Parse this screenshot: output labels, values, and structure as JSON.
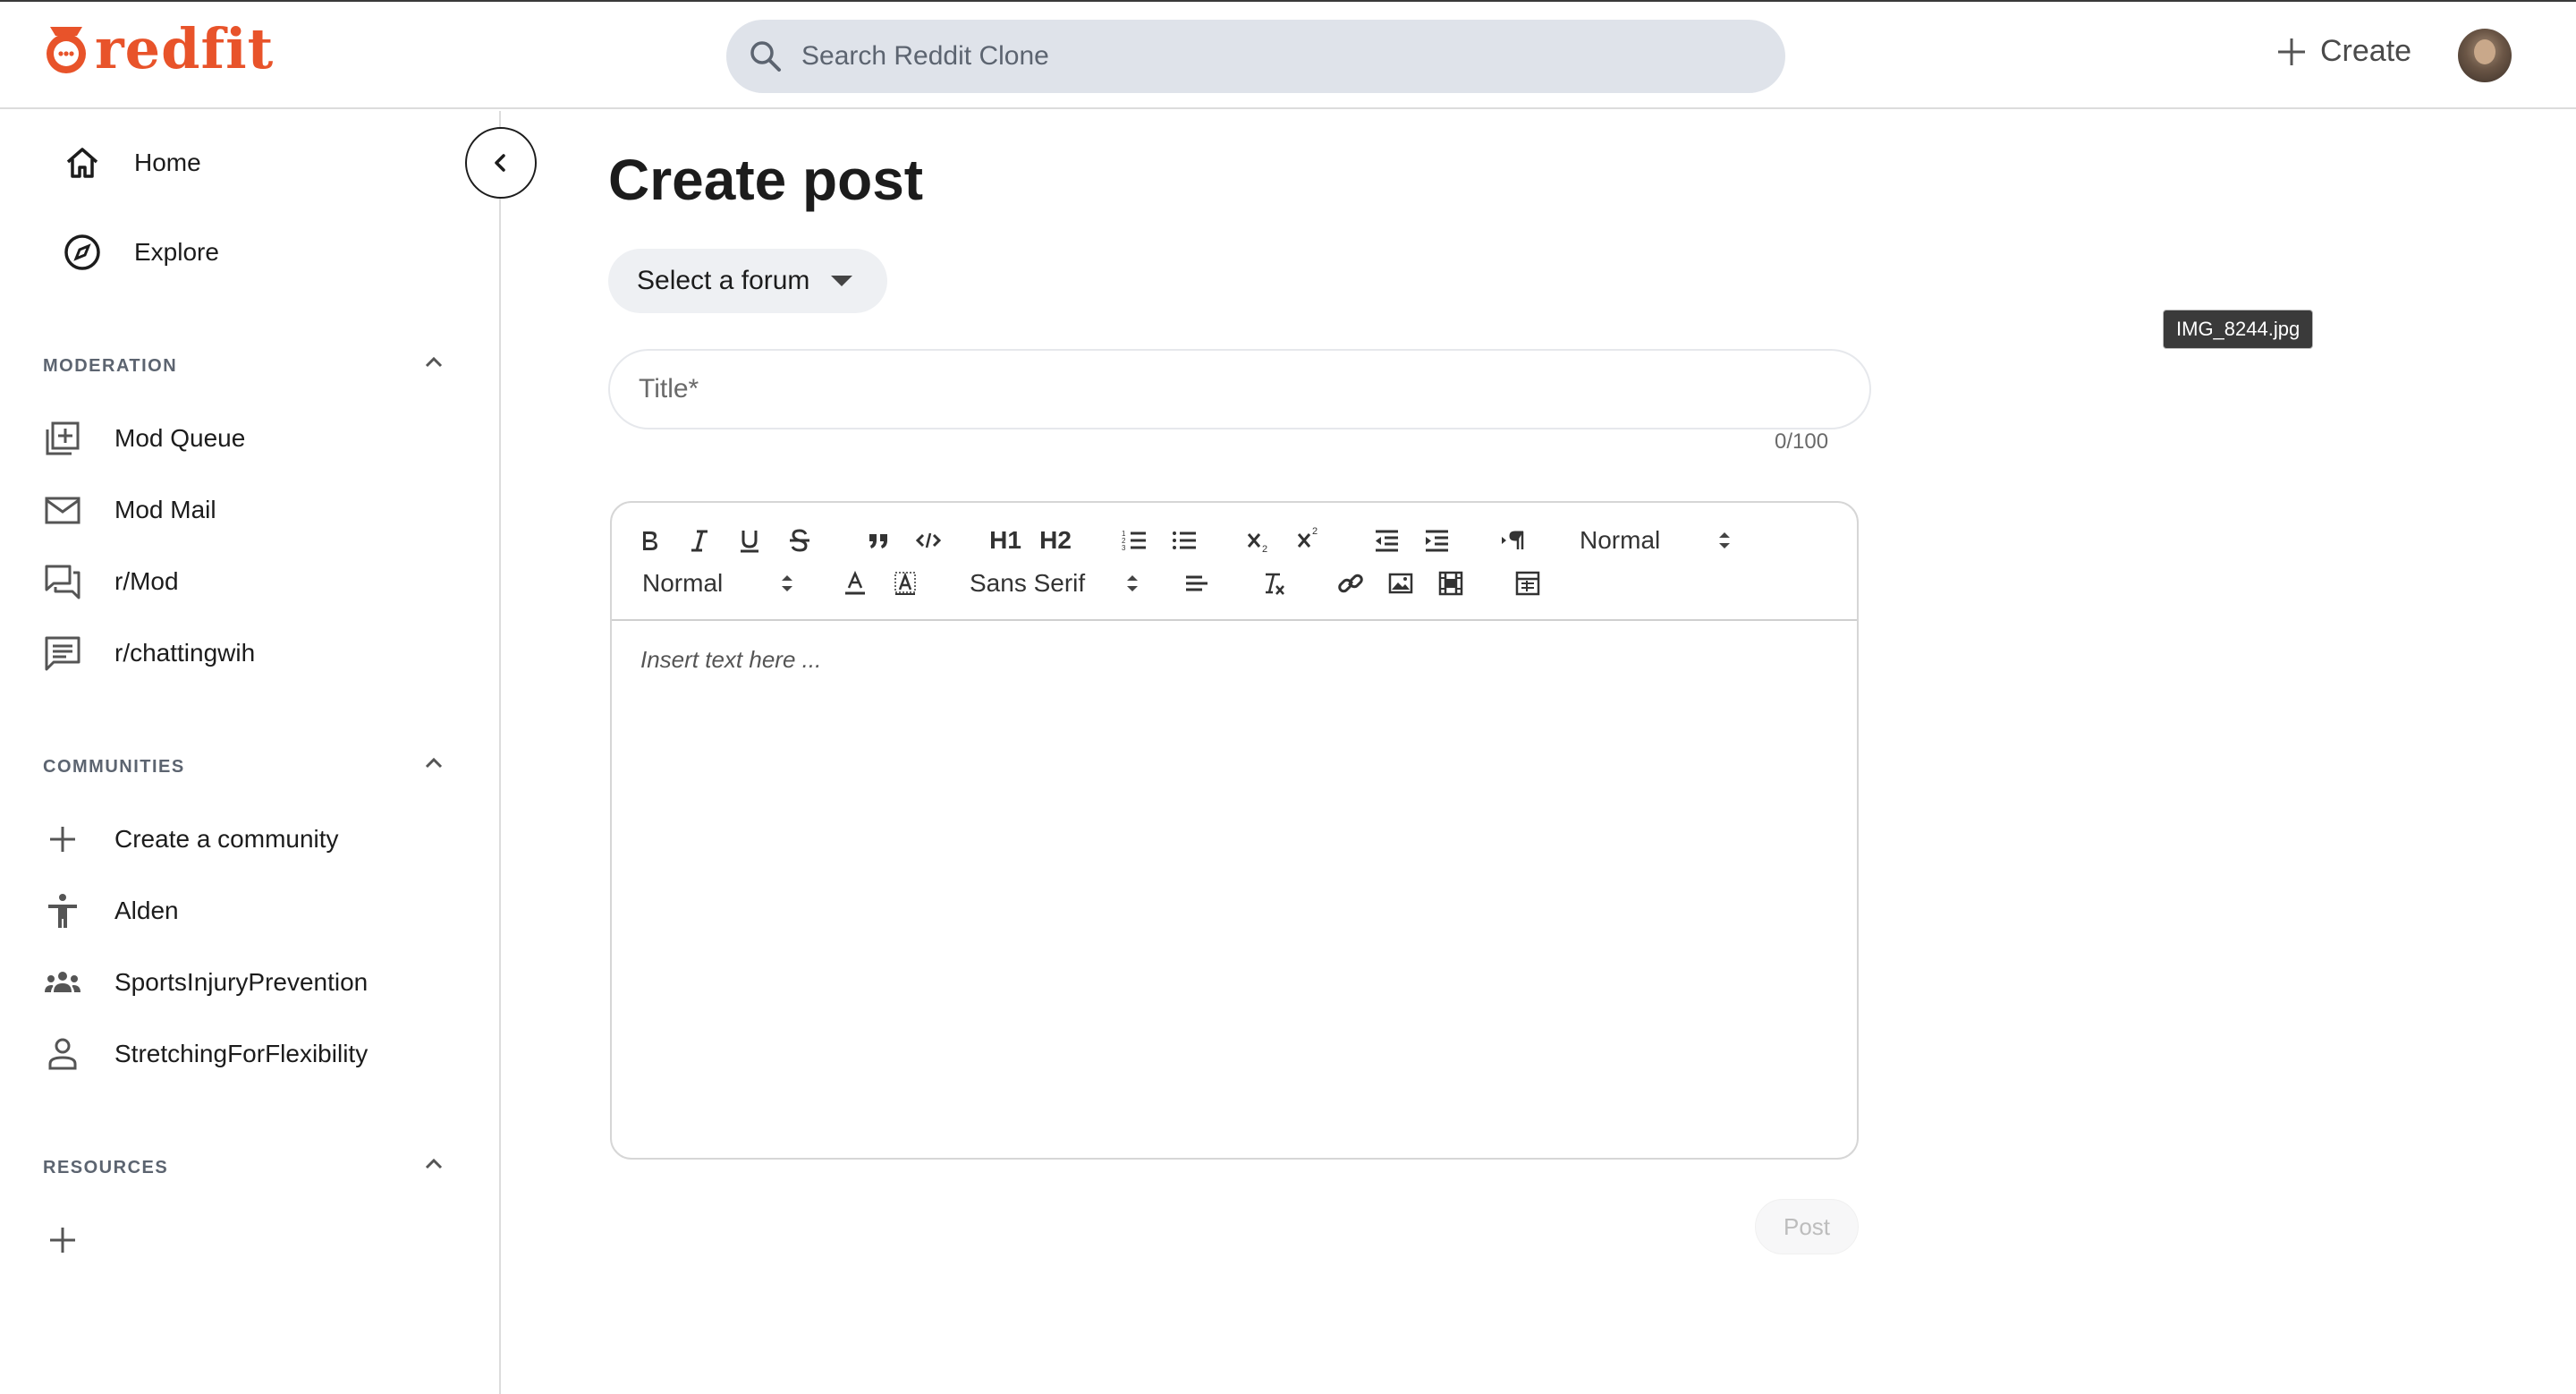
{
  "app": {
    "name": "redfit"
  },
  "colors": {
    "brand": "#e8532a",
    "search_bg": "#dfe3ea",
    "text": "#1c1c1c"
  },
  "header": {
    "search_placeholder": "Search Reddit Clone",
    "create_label": "Create"
  },
  "sidebar": {
    "nav": [
      {
        "label": "Home",
        "icon": "home-icon"
      },
      {
        "label": "Explore",
        "icon": "compass-icon"
      }
    ],
    "moderation": {
      "title": "MODERATION",
      "items": [
        {
          "label": "Mod Queue",
          "icon": "queue-add-icon"
        },
        {
          "label": "Mod Mail",
          "icon": "mail-icon"
        },
        {
          "label": "r/Mod",
          "icon": "forum-icon"
        },
        {
          "label": "r/chattingwih",
          "icon": "chat-icon"
        }
      ]
    },
    "communities": {
      "title": "COMMUNITIES",
      "items": [
        {
          "label": "Create a community",
          "icon": "plus-icon"
        },
        {
          "label": "Alden",
          "icon": "accessibility-icon"
        },
        {
          "label": "SportsInjuryPrevention",
          "icon": "group-icon"
        },
        {
          "label": "StretchingForFlexibility",
          "icon": "person-icon"
        }
      ]
    },
    "resources": {
      "title": "RESOURCES"
    }
  },
  "main": {
    "page_title": "Create post",
    "forum_select_label": "Select a forum",
    "title_placeholder": "Title*",
    "char_count": "0/100",
    "toolbar": {
      "h1": "H1",
      "h2": "H2",
      "header_select": "Normal",
      "size_select": "Normal",
      "font_select": "Sans Serif"
    },
    "editor_placeholder": "Insert text here ...",
    "post_label": "Post"
  },
  "tooltip": {
    "text": "IMG_8244.jpg"
  }
}
